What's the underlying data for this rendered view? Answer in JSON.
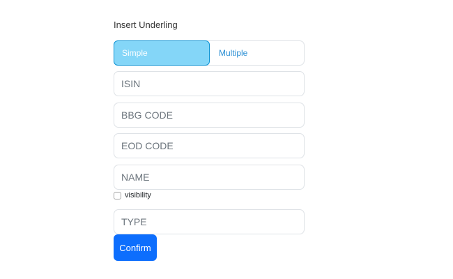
{
  "form": {
    "title": "Insert Underling",
    "mode_toggle": {
      "options": [
        {
          "label": "Simple",
          "active": true
        },
        {
          "label": "Multiple",
          "active": false
        }
      ]
    },
    "fields": {
      "isin": {
        "placeholder": "ISIN",
        "value": ""
      },
      "bbg_code": {
        "placeholder": "BBG CODE",
        "value": ""
      },
      "eod_code": {
        "placeholder": "EOD CODE",
        "value": ""
      },
      "name": {
        "placeholder": "NAME",
        "value": ""
      },
      "type": {
        "placeholder": "TYPE",
        "value": ""
      }
    },
    "visibility": {
      "label": "visibility",
      "checked": false
    },
    "confirm_label": "Confirm"
  },
  "colors": {
    "toggle_active_bg": "#84d6f8",
    "toggle_active_border": "#0d93d4",
    "toggle_inactive_text": "#2a8fd4",
    "primary_button": "#0d6efd",
    "input_border": "#dee2e6"
  }
}
